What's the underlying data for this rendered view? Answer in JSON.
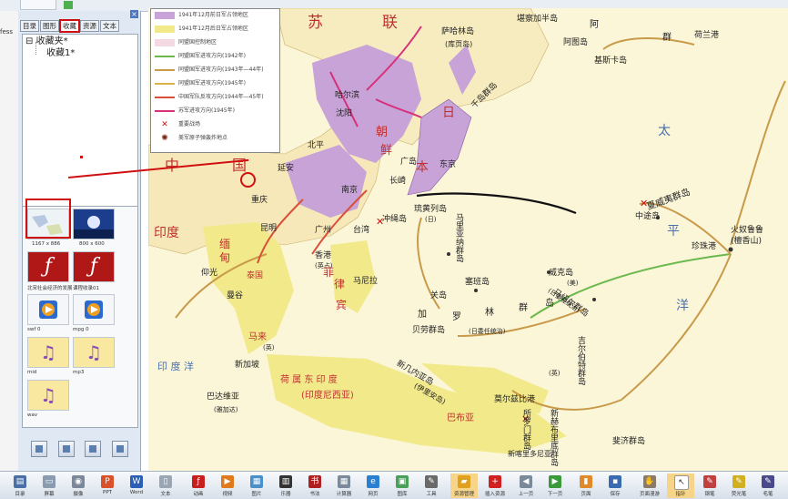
{
  "top": {
    "tab_label": ""
  },
  "left_fragment": "fess",
  "panel": {
    "close_glyph": "×",
    "tabs": [
      "目录",
      "图形",
      "收藏",
      "资源",
      "文本"
    ],
    "active_tab": "收藏",
    "tree": [
      {
        "toggle": "⊟",
        "label": "收藏夹*"
      },
      {
        "label": "收藏1*"
      }
    ],
    "thumbnails": [
      {
        "caption": "1167 x 886",
        "icon": "map-thumbnail"
      },
      {
        "caption": "800 x 600",
        "icon": "moon-thumbnail"
      },
      {
        "caption": "北宋社会经济的发展",
        "icon": "flash-icon"
      },
      {
        "caption": "课程收录01",
        "icon": "flash-icon"
      },
      {
        "caption": "swf 0",
        "icon": "media-player-icon"
      },
      {
        "caption": "mpg 0",
        "icon": "media-player-icon"
      },
      {
        "caption": "mid",
        "icon": "music-note-icon"
      },
      {
        "caption": "mp3",
        "icon": "music-note-icon"
      },
      {
        "caption": "wav",
        "icon": "music-note-icon"
      }
    ]
  },
  "map": {
    "legend": [
      {
        "color": "#c8a3d8",
        "text": "1941年12月前日军占领地区"
      },
      {
        "color": "#f2ea8a",
        "text": "1941年12月后日军占领地区"
      },
      {
        "color": "#f4d9e3",
        "text": "同盟国控制地区"
      },
      {
        "color": "#6bb84d",
        "text": "同盟国军进攻方向(1942年)"
      },
      {
        "color": "#c89a4a",
        "text": "同盟国军进攻方向(1943年—44年)"
      },
      {
        "color": "#d9b24a",
        "text": "同盟国军进攻方向(1945年)"
      },
      {
        "color": "#d9503a",
        "text": "中国军队反攻方向(1944年—45年)"
      },
      {
        "color": "#d8307a",
        "text": "苏军进攻方向(1945年)"
      },
      {
        "color": "#d01010",
        "text": "重要战场"
      },
      {
        "color": "#7a2010",
        "text": "美军原子弹轰炸地点"
      }
    ],
    "labels": {
      "su": "苏",
      "lian": "联",
      "zhong": "中",
      "guo": "国",
      "yindu": "印度",
      "saha": "萨哈林岛",
      "kuye": "(库页岛)",
      "kanchaka": "堪察加半岛",
      "aliu": "阿",
      "alitu": "阿图岛",
      "qun": "群",
      "kis": "基斯卡岛",
      "likelan": "荷兰港",
      "ha": "哈尔滨",
      "shen": "沈阳",
      "bei": "北平",
      "yan": "延安",
      "chao": "朝",
      "xian": "鲜",
      "ri": "日",
      "ben": "本",
      "guang": "广岛",
      "dongj": "东京",
      "chang": "长崎",
      "nanj": "南京",
      "qianq": "千岛群岛",
      "chongq": "重庆",
      "kunm": "昆明",
      "guangz": "广州",
      "xiang": "香港",
      "xianggang": "(英占)",
      "taiw": "台湾",
      "chongsheng": "冲绳岛",
      "liuqiu": "琉黄列岛",
      "liuqiu2": "(日)",
      "mian": "缅",
      "dian": "甸",
      "yangg": "仰光",
      "tai": "泰国",
      "mang": "曼谷",
      "fei": "菲",
      "lvb": "律",
      "bin": "宾",
      "manila": "马尼拉",
      "malai": "马来",
      "malaia": "(英)",
      "xinj": "新加坡",
      "helan": "荷 属 东 印 度",
      "yindunixiya": "(印度尼西亚)",
      "bada": "巴达维亚",
      "yajia": "(雅加达)",
      "yinduyang": "印 度 洋",
      "mali": "马里亚纳群岛",
      "guan": "关岛",
      "ka": "加",
      "luo": "罗",
      "lin": "林",
      "qun2": "群",
      "dao": "岛",
      "rituo": "(日委任统治)",
      "sipan": "塞班岛",
      "xin": "新几内亚岛",
      "yili": "(伊里安岛)",
      "babu": "巴布亚",
      "mos": "莫尔兹比港",
      "weik": "威克岛",
      "meiguo": "(美)",
      "mashao": "马绍尔群岛",
      "mashao2": "(日委任统治)",
      "jier": "吉尔伯特群岛",
      "jier2": "(英)",
      "weiyi": "夏威夷群岛",
      "zhongt": "中途岛",
      "huonu": "火奴鲁鲁",
      "tanx": "(檀香山)",
      "zhenz": "珍珠港",
      "taiping": "太",
      "ping": "平",
      "yang": "洋",
      "suoluomen": "所罗门群岛",
      "xinhe": "新赫布里底群岛",
      "feiji": "斐济群岛",
      "beilao": "贝劳群岛",
      "xinli": "新喀里多尼亚"
    }
  },
  "toolbar": [
    {
      "label": "目录",
      "icon": "catalog-icon",
      "color": "#4a6fa5",
      "glyph": "▤"
    },
    {
      "label": "屏幕",
      "icon": "screen-icon",
      "color": "#8a9bb0",
      "glyph": "▭"
    },
    {
      "label": "摄像",
      "icon": "camera-icon",
      "color": "#7a8899",
      "glyph": "◉"
    },
    {
      "label": "PPT",
      "icon": "ppt-icon",
      "color": "#d9502a",
      "glyph": "P"
    },
    {
      "label": "Word",
      "icon": "word-icon",
      "color": "#2b5fb5",
      "glyph": "W"
    },
    {
      "label": "文本",
      "icon": "text-icon",
      "color": "#9aa6b4",
      "glyph": "▯"
    },
    {
      "label": "动画",
      "icon": "flash-icon",
      "color": "#c81e1e",
      "glyph": "ƒ"
    },
    {
      "label": "视频",
      "icon": "video-icon",
      "color": "#e07a1a",
      "glyph": "▶"
    },
    {
      "label": "图片",
      "icon": "picture-icon",
      "color": "#4a8fc8",
      "glyph": "▦"
    },
    {
      "label": "乐器",
      "icon": "piano-icon",
      "color": "#333333",
      "glyph": "▥"
    },
    {
      "label": "书法",
      "icon": "calligraphy-icon",
      "color": "#b02020",
      "glyph": "书"
    },
    {
      "label": "计算器",
      "icon": "calculator-icon",
      "color": "#7b8a9a",
      "glyph": "▦"
    },
    {
      "label": "网页",
      "icon": "browser-icon",
      "color": "#2a7fd0",
      "glyph": "e"
    },
    {
      "label": "图库",
      "icon": "gallery-icon",
      "color": "#4aa05a",
      "glyph": "▣"
    },
    {
      "label": "工具",
      "icon": "tools-icon",
      "color": "#6a6a6a",
      "glyph": "✎"
    },
    {
      "label": "资源管理",
      "icon": "folder-icon",
      "color": "#e0a020",
      "glyph": "▰",
      "highlight": true
    },
    {
      "label": "插入资源",
      "icon": "insert-icon",
      "color": "#d02020",
      "glyph": "+"
    },
    {
      "label": "上一页",
      "icon": "prev-page-icon",
      "color": "#7a8a9a",
      "glyph": "◀"
    },
    {
      "label": "下一页",
      "icon": "next-page-icon",
      "color": "#3a9a3a",
      "glyph": "▶"
    },
    {
      "label": "页面",
      "icon": "page-icon",
      "color": "#e08a2a",
      "glyph": "▮"
    },
    {
      "label": "保存",
      "icon": "save-icon",
      "color": "#3a6ab0",
      "glyph": "▪"
    },
    {
      "label": "页面漫游",
      "icon": "hand-icon",
      "color": "#8a7a6a",
      "glyph": "✋"
    },
    {
      "label": "指针",
      "icon": "pointer-icon",
      "color": "#ffffff",
      "glyph": "↖",
      "highlight": true
    },
    {
      "label": "钢笔",
      "icon": "pen-icon",
      "color": "#c04040",
      "glyph": "✎"
    },
    {
      "label": "荧光笔",
      "icon": "highlighter-icon",
      "color": "#d0b020",
      "glyph": "✎"
    },
    {
      "label": "毛笔",
      "icon": "brush-icon",
      "color": "#4a4a8a",
      "glyph": "✎"
    }
  ]
}
